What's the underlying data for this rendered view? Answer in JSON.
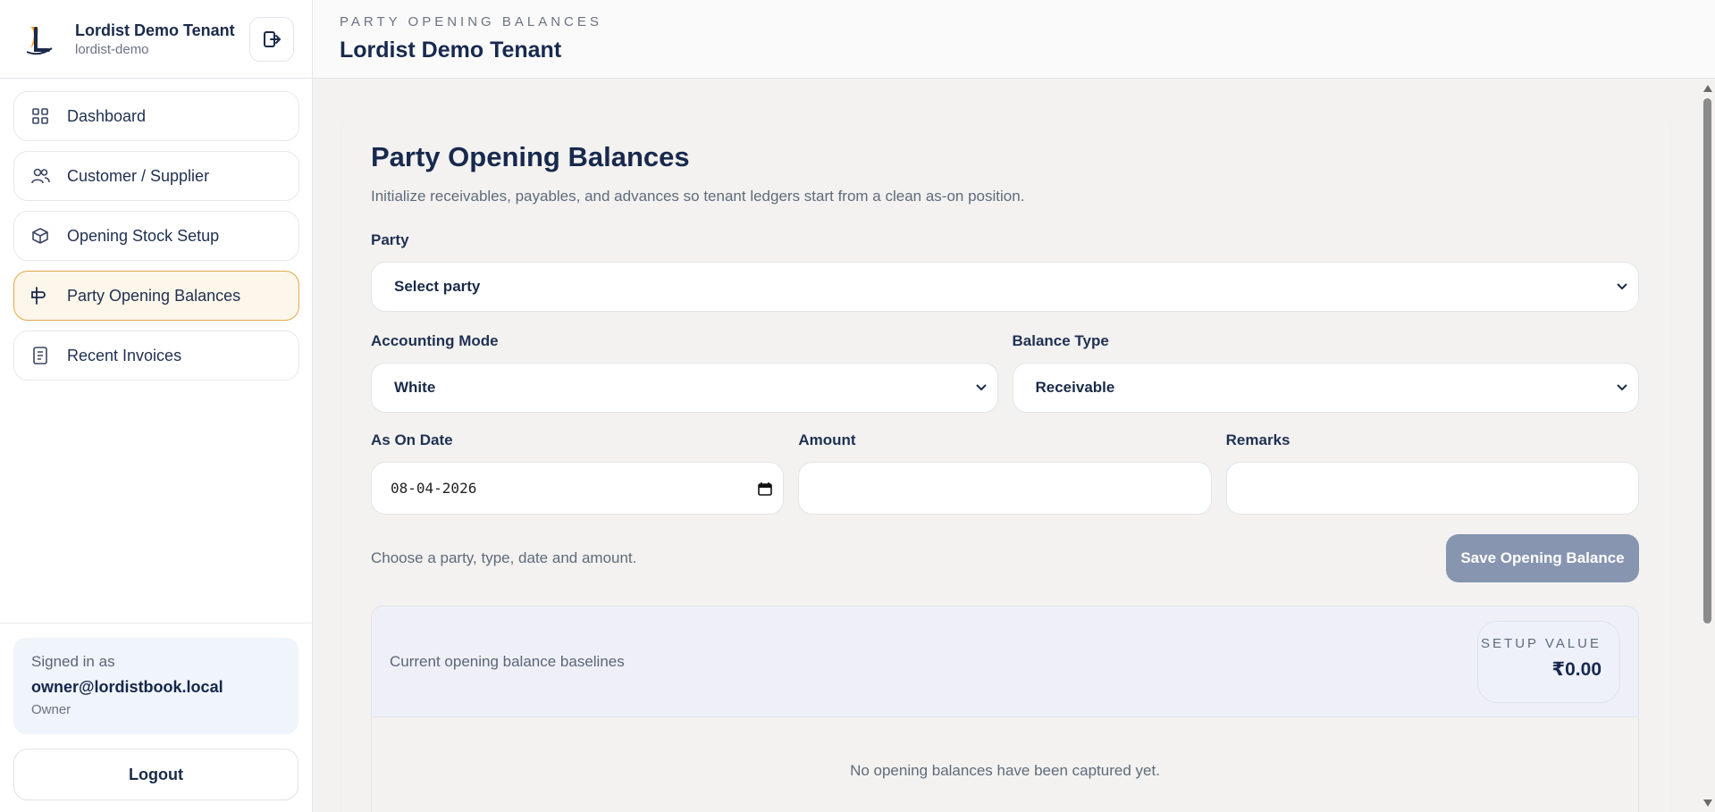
{
  "sidebar": {
    "brand_name": "Lordist Demo Tenant",
    "brand_slug": "lordist-demo",
    "nav": [
      {
        "label": "Dashboard",
        "icon": "grid-icon"
      },
      {
        "label": "Customer / Supplier",
        "icon": "users-icon"
      },
      {
        "label": "Opening Stock Setup",
        "icon": "box-icon"
      },
      {
        "label": "Party Opening Balances",
        "icon": "signpost-icon",
        "active": true
      },
      {
        "label": "Recent Invoices",
        "icon": "receipt-icon"
      }
    ],
    "user": {
      "label": "Signed in as",
      "email": "owner@lordistbook.local",
      "role": "Owner"
    },
    "logout_label": "Logout"
  },
  "header": {
    "eyebrow": "PARTY OPENING BALANCES",
    "title": "Lordist Demo Tenant"
  },
  "form": {
    "title": "Party Opening Balances",
    "subtitle": "Initialize receivables, payables, and advances so tenant ledgers start from a clean as-on position.",
    "party_label": "Party",
    "party_value": "Select party",
    "mode_label": "Accounting Mode",
    "mode_value": "White",
    "type_label": "Balance Type",
    "type_value": "Receivable",
    "date_label": "As On Date",
    "date_value": "08-04-2026",
    "amount_label": "Amount",
    "amount_value": "",
    "remarks_label": "Remarks",
    "remarks_value": "",
    "hint": "Choose a party, type, date and amount.",
    "save_label": "Save Opening Balance"
  },
  "baseline": {
    "title": "Current opening balance baselines",
    "setup_label": "SETUP VALUE",
    "setup_value": "₹0.00",
    "empty_text": "No opening balances have been captured yet."
  },
  "colors": {
    "accent": "#e2a948",
    "primary_text": "#17294d",
    "save_button": "#8795b0"
  }
}
